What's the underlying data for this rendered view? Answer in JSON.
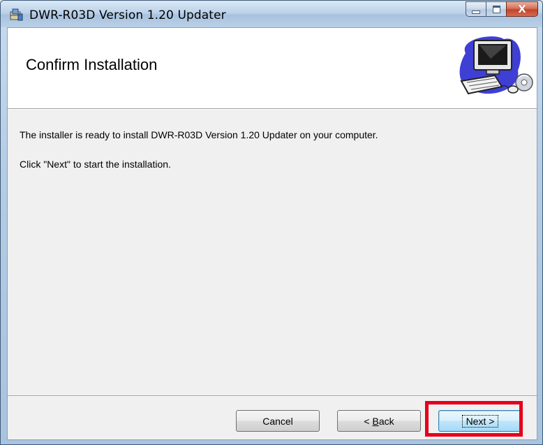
{
  "window": {
    "title": "DWR-R03D Version 1.20 Updater",
    "icons": {
      "app": "installer-package-icon",
      "minimize": "minimize-icon",
      "maximize": "maximize-icon",
      "close": "close-icon"
    },
    "close_glyph": "X"
  },
  "banner": {
    "title": "Confirm Installation",
    "graphic": "computer-setup-graphic"
  },
  "body": {
    "line1": "The installer is ready to install DWR-R03D Version 1.20 Updater on your computer.",
    "line2": "Click \"Next\" to start the installation."
  },
  "buttons": {
    "cancel": "Cancel",
    "back_prefix": "< ",
    "back_mnemonic": "B",
    "back_rest": "ack",
    "next": "Next >"
  },
  "colors": {
    "highlight": "#e4001b",
    "dialog_bg": "#f0f0f0",
    "banner_bg": "#ffffff"
  }
}
